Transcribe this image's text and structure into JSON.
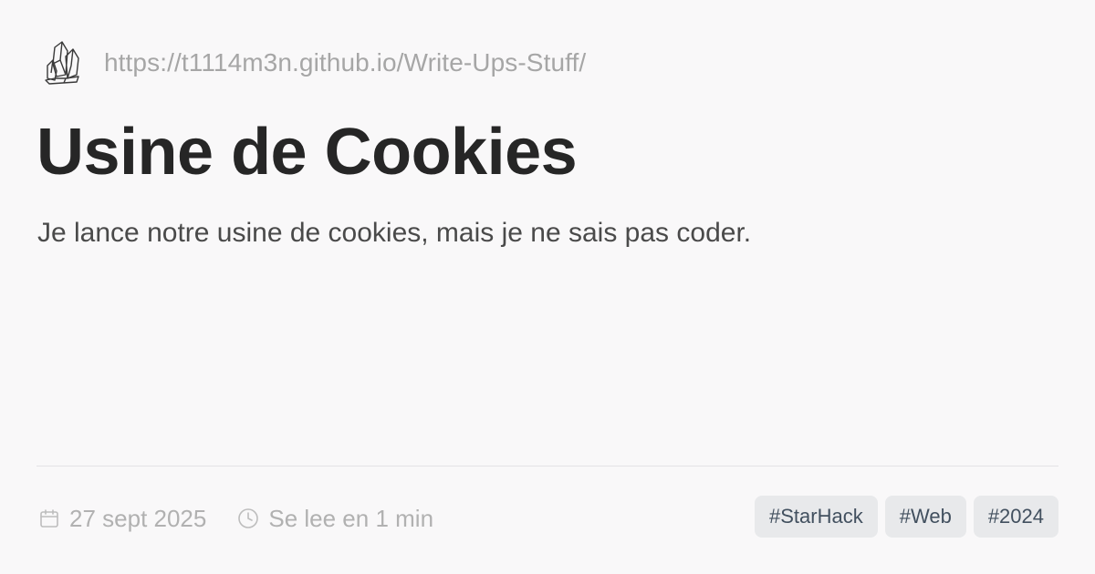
{
  "header": {
    "logo_icon": "crystal-cluster-icon",
    "site_url": "https://t1114m3n.github.io/Write-Ups-Stuff/"
  },
  "article": {
    "title": "Usine de Cookies",
    "description": "Je lance notre usine de cookies, mais je ne sais pas coder."
  },
  "meta": {
    "date_icon": "calendar-icon",
    "date": "27 sept 2025",
    "read_time_icon": "clock-icon",
    "read_time": "Se lee en 1 min"
  },
  "tags": [
    "#StarHack",
    "#Web",
    "#2024"
  ],
  "colors": {
    "background": "#f9f8f9",
    "title": "#262626",
    "muted": "#a6a6a6",
    "tag_background": "#e8e9eb",
    "tag_text": "#42505f"
  }
}
